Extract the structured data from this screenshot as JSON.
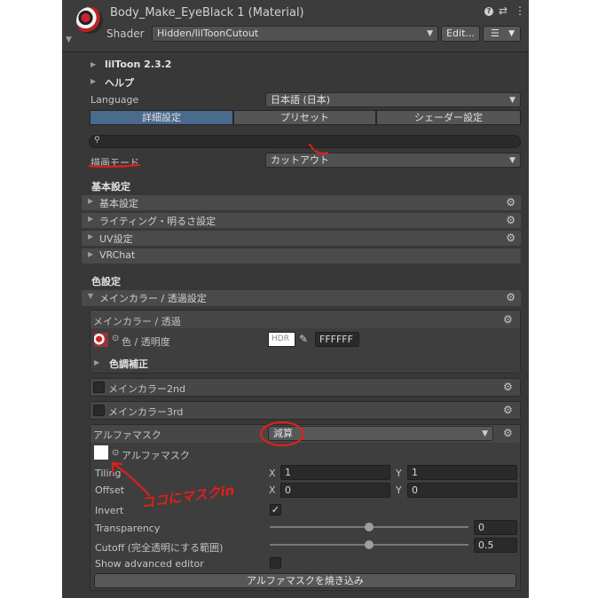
{
  "header": {
    "title": "Body_Make_EyeBlack 1 (Material)",
    "shader_label": "Shader",
    "shader_value": "Hidden/lilToonCutout",
    "edit_button": "Edit...",
    "list_button": "☰"
  },
  "foldouts": {
    "version": "lilToon 2.3.2",
    "help": "ヘルプ"
  },
  "language": {
    "label": "Language",
    "value": "日本語 (日本)"
  },
  "tabs": [
    "詳細設定",
    "プリセット",
    "シェーダー設定"
  ],
  "search": {
    "placeholder": ""
  },
  "render_mode": {
    "label": "描画モード",
    "value": "カットアウト"
  },
  "basic_settings": {
    "heading": "基本設定",
    "sections": [
      "基本設定",
      "ライティング・明るさ設定",
      "UV設定",
      "VRChat"
    ]
  },
  "color_settings": {
    "heading": "色設定",
    "main_section": "メインカラー / 透過設定",
    "main_color_box": {
      "title": "メインカラー / 透過",
      "color_label": "色 / 透明度",
      "hdr": "HDR",
      "hex": "FFFFFF",
      "color_adjust": "色調補正"
    },
    "main_color_2nd": "メインカラー2nd",
    "main_color_3rd": "メインカラー3rd"
  },
  "alpha_mask": {
    "title": "アルファマスク",
    "mode": "減算",
    "texture_label": "アルファマスク",
    "tiling_label": "Tiling",
    "offset_label": "Offset",
    "tiling_x": "1",
    "tiling_y": "1",
    "offset_x": "0",
    "offset_y": "0",
    "x": "X",
    "y": "Y",
    "invert_label": "Invert",
    "transparency_label": "Transparency",
    "transparency_value": "0",
    "cutoff_label": "Cutoff (完全透明にする範囲)",
    "cutoff_value": "0.5",
    "advanced_label": "Show advanced editor",
    "bake_button": "アルファマスクを焼き込み"
  },
  "annotation": {
    "handwritten": "ココにマスクin"
  },
  "colors": {
    "panel": "#383838",
    "selected_tab": "#4a6a8e",
    "annotation": "#e0201a"
  }
}
